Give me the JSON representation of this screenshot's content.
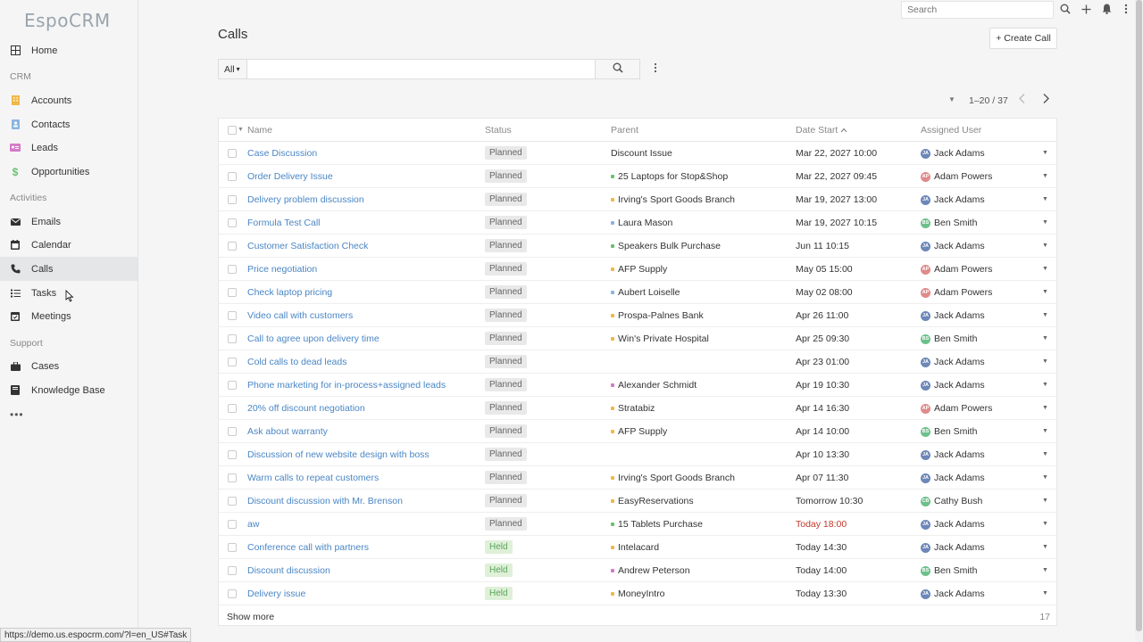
{
  "brand": {
    "logo_text": "EspoCRM"
  },
  "sidebar": {
    "home": "Home",
    "group_crm": "CRM",
    "accounts": "Accounts",
    "contacts": "Contacts",
    "leads": "Leads",
    "opportunities": "Opportunities",
    "group_activities": "Activities",
    "emails": "Emails",
    "calendar": "Calendar",
    "calls": "Calls",
    "tasks": "Tasks",
    "meetings": "Meetings",
    "group_support": "Support",
    "cases": "Cases",
    "knowledge_base": "Knowledge Base",
    "more": "•••"
  },
  "topbar": {
    "search_placeholder": "Search"
  },
  "header": {
    "title": "Calls",
    "create_button": "+ Create Call"
  },
  "filter": {
    "scope": "All",
    "scope_caret": "▾"
  },
  "pagination": {
    "text": "1–20 / 37"
  },
  "table": {
    "columns": {
      "name": "Name",
      "status": "Status",
      "parent": "Parent",
      "date_start": "Date Start",
      "assigned_user": "Assigned User"
    },
    "rows": [
      {
        "name": "Case Discussion",
        "status": "Planned",
        "parent": "Discount Issue",
        "parent_color": "",
        "date": "Mar 22, 2027 10:00",
        "date_red": false,
        "user": "Jack Adams",
        "initials": "JA",
        "user_color": "#6c87b8"
      },
      {
        "name": "Order Delivery Issue",
        "status": "Planned",
        "parent": "25 Laptops for Stop&Shop",
        "parent_color": "#6cc070",
        "date": "Mar 22, 2027 09:45",
        "date_red": false,
        "user": "Adam Powers",
        "initials": "AP",
        "user_color": "#e08a8a"
      },
      {
        "name": "Delivery problem discussion",
        "status": "Planned",
        "parent": "Irving's Sport Goods Branch",
        "parent_color": "#f0b848",
        "date": "Mar 19, 2027 13:00",
        "date_red": false,
        "user": "Jack Adams",
        "initials": "JA",
        "user_color": "#6c87b8"
      },
      {
        "name": "Formula Test Call",
        "status": "Planned",
        "parent": "Laura Mason",
        "parent_color": "#8ab4e0",
        "date": "Mar 19, 2027 10:15",
        "date_red": false,
        "user": "Ben Smith",
        "initials": "BS",
        "user_color": "#6cc08a"
      },
      {
        "name": "Customer Satisfaction Check",
        "status": "Planned",
        "parent": "Speakers Bulk Purchase",
        "parent_color": "#6cc070",
        "date": "Jun 11 10:15",
        "date_red": false,
        "user": "Jack Adams",
        "initials": "JA",
        "user_color": "#6c87b8"
      },
      {
        "name": "Price negotiation",
        "status": "Planned",
        "parent": "AFP Supply",
        "parent_color": "#f0b848",
        "date": "May 05 15:00",
        "date_red": false,
        "user": "Adam Powers",
        "initials": "AP",
        "user_color": "#e08a8a"
      },
      {
        "name": "Check laptop pricing",
        "status": "Planned",
        "parent": "Aubert Loiselle",
        "parent_color": "#8ab4e0",
        "date": "May 02 08:00",
        "date_red": false,
        "user": "Adam Powers",
        "initials": "AP",
        "user_color": "#e08a8a"
      },
      {
        "name": "Video call with customers",
        "status": "Planned",
        "parent": "Prospa-Palnes Bank",
        "parent_color": "#f0b848",
        "date": "Apr 26 11:00",
        "date_red": false,
        "user": "Jack Adams",
        "initials": "JA",
        "user_color": "#6c87b8"
      },
      {
        "name": "Call to agree upon delivery time",
        "status": "Planned",
        "parent": "Win's Private Hospital",
        "parent_color": "#f0b848",
        "date": "Apr 25 09:30",
        "date_red": false,
        "user": "Ben Smith",
        "initials": "BS",
        "user_color": "#6cc08a"
      },
      {
        "name": "Cold calls to dead leads",
        "status": "Planned",
        "parent": "",
        "parent_color": "",
        "date": "Apr 23 01:00",
        "date_red": false,
        "user": "Jack Adams",
        "initials": "JA",
        "user_color": "#6c87b8"
      },
      {
        "name": "Phone marketing for in-process+assigned leads",
        "status": "Planned",
        "parent": "Alexander Schmidt",
        "parent_color": "#d47ac8",
        "date": "Apr 19 10:30",
        "date_red": false,
        "user": "Jack Adams",
        "initials": "JA",
        "user_color": "#6c87b8"
      },
      {
        "name": "20% off discount negotiation",
        "status": "Planned",
        "parent": "Stratabiz",
        "parent_color": "#f0b848",
        "date": "Apr 14 16:30",
        "date_red": false,
        "user": "Adam Powers",
        "initials": "AP",
        "user_color": "#e08a8a"
      },
      {
        "name": "Ask about warranty",
        "status": "Planned",
        "parent": "AFP Supply",
        "parent_color": "#f0b848",
        "date": "Apr 14 10:00",
        "date_red": false,
        "user": "Ben Smith",
        "initials": "BS",
        "user_color": "#6cc08a"
      },
      {
        "name": "Discussion of new website design with boss",
        "status": "Planned",
        "parent": "",
        "parent_color": "",
        "date": "Apr 10 13:30",
        "date_red": false,
        "user": "Jack Adams",
        "initials": "JA",
        "user_color": "#6c87b8"
      },
      {
        "name": "Warm calls to repeat customers",
        "status": "Planned",
        "parent": "Irving's Sport Goods Branch",
        "parent_color": "#f0b848",
        "date": "Apr 07 11:30",
        "date_red": false,
        "user": "Jack Adams",
        "initials": "JA",
        "user_color": "#6c87b8"
      },
      {
        "name": "Discount discussion with Mr. Brenson",
        "status": "Planned",
        "parent": "EasyReservations",
        "parent_color": "#f0b848",
        "date": "Tomorrow 10:30",
        "date_red": false,
        "user": "Cathy Bush",
        "initials": "CB",
        "user_color": "#6cc08a"
      },
      {
        "name": "aw",
        "status": "Planned",
        "parent": "15 Tablets Purchase",
        "parent_color": "#6cc070",
        "date": "Today 18:00",
        "date_red": true,
        "user": "Jack Adams",
        "initials": "JA",
        "user_color": "#6c87b8"
      },
      {
        "name": "Conference call with partners",
        "status": "Held",
        "parent": "Intelacard",
        "parent_color": "#f0b848",
        "date": "Today 14:30",
        "date_red": false,
        "user": "Jack Adams",
        "initials": "JA",
        "user_color": "#6c87b8"
      },
      {
        "name": "Discount discussion",
        "status": "Held",
        "parent": "Andrew Peterson",
        "parent_color": "#d47ac8",
        "date": "Today 14:00",
        "date_red": false,
        "user": "Ben Smith",
        "initials": "BS",
        "user_color": "#6cc08a"
      },
      {
        "name": "Delivery issue",
        "status": "Held",
        "parent": "MoneyIntro",
        "parent_color": "#f0b848",
        "date": "Today 13:30",
        "date_red": false,
        "user": "Jack Adams",
        "initials": "JA",
        "user_color": "#6c87b8"
      }
    ],
    "show_more": "Show more",
    "remaining": "17"
  },
  "status_bar": {
    "url": "https://demo.us.espocrm.com/?l=en_US#Task"
  },
  "colors": {
    "link": "#4a86c5",
    "held_bg": "#dff0d8",
    "held_text": "#5aa55a",
    "planned_bg": "#e9e9e9",
    "today_red": "#c0392b"
  }
}
